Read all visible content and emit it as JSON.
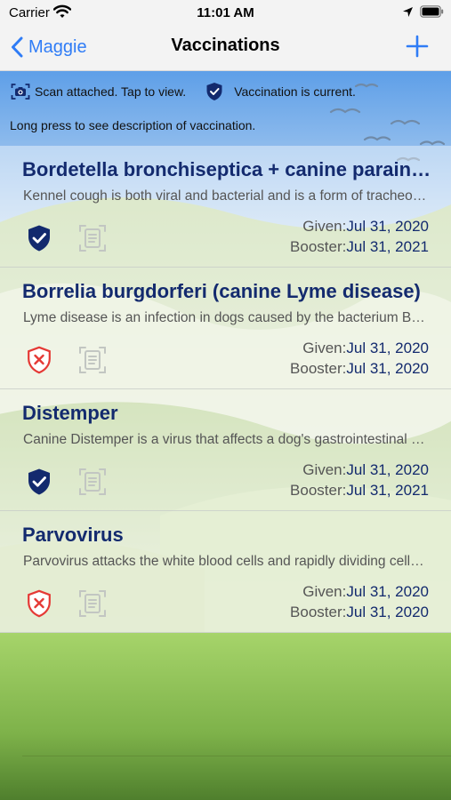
{
  "status_bar": {
    "carrier": "Carrier",
    "time": "11:01 AM"
  },
  "nav": {
    "back_label": "Maggie",
    "title": "Vaccinations"
  },
  "legend": {
    "scan_text": "Scan attached. Tap to view.",
    "current_text": "Vaccination is current.",
    "hint": "Long press to see description of vaccination."
  },
  "labels": {
    "given": "Given:",
    "booster": "Booster:"
  },
  "colors": {
    "accent": "#2f7cf6",
    "name": "#132a6e",
    "current": "#132a6e",
    "expired": "#e53935"
  },
  "vaccinations": [
    {
      "name": "Bordetella bronchiseptica  + canine parainfluenza",
      "description": "Kennel cough is both viral and bacterial and is a form of tracheobronchitis",
      "given": "Jul 31, 2020",
      "booster": "Jul 31, 2021",
      "status": "current"
    },
    {
      "name": "Borrelia burgdorferi (canine Lyme disease)",
      "description": "Lyme disease is an infection in dogs caused by the bacterium Borrelia burgdorferi",
      "given": "Jul 31, 2020",
      "booster": "Jul 31, 2020",
      "status": "expired"
    },
    {
      "name": "Distemper",
      "description": "Canine Distemper is a virus that affects a dog's gastrointestinal and respiratory systems",
      "given": "Jul 31, 2020",
      "booster": "Jul 31, 2021",
      "status": "current"
    },
    {
      "name": "Parvovirus",
      "description": "Parvovirus attacks the white blood cells and rapidly dividing cells of the intestine",
      "given": "Jul 31, 2020",
      "booster": "Jul 31, 2020",
      "status": "expired"
    }
  ]
}
